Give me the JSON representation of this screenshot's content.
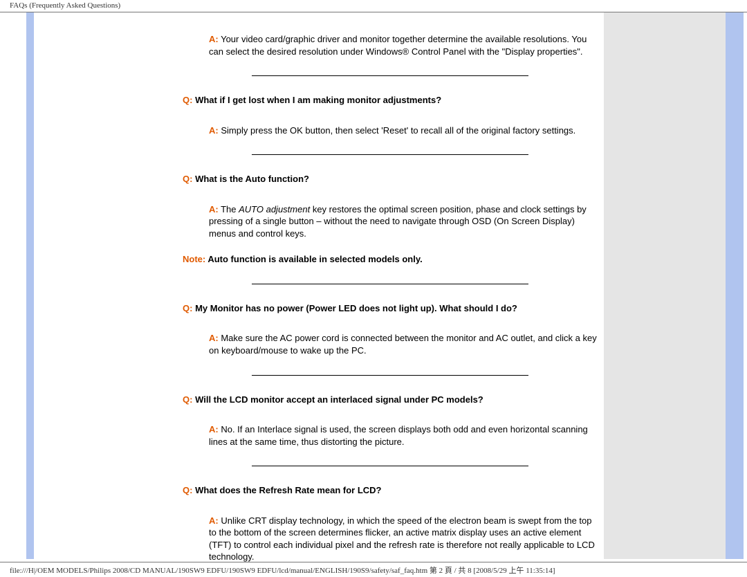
{
  "header": "FAQs (Frequently Asked Questions)",
  "footer": "file:///H|/OEM MODELS/Philips 2008/CD MANUAL/190SW9 EDFU/190SW9 EDFU/lcd/manual/ENGLISH/190S9/safety/saf_faq.htm 第 2 頁 / 共 8 [2008/5/29 上午 11:35:14]",
  "labels": {
    "q": "Q:",
    "a": "A:",
    "note": "Note:"
  },
  "faq": [
    {
      "a_pre": " Your video card/graphic driver and monitor together determine the available resolutions. You can select the desired resolution under Windows® Control Panel with the \"Display properties\"."
    },
    {
      "q": " What if I get lost when I am making monitor adjustments?",
      "a": " Simply press the OK button, then select 'Reset' to recall all of the original factory settings."
    },
    {
      "q": " What is the Auto function?",
      "a_part1": " The ",
      "a_italic": "AUTO adjustment",
      "a_part2": " key restores the optimal screen position, phase and clock settings by pressing of a single button – without the need to navigate through OSD (On Screen Display) menus and control keys.",
      "note": " Auto function is available in selected models only."
    },
    {
      "q": " My Monitor has no power (Power LED does not light up). What should I do?",
      "a": " Make sure the AC power cord is connected between the monitor and AC outlet, and click a key on keyboard/mouse to wake up the PC."
    },
    {
      "q": " Will the LCD monitor accept an interlaced signal under PC models?",
      "a": " No. If an Interlace signal is used, the screen displays both odd and even horizontal scanning lines at the same time, thus distorting the picture."
    },
    {
      "q": " What does the Refresh Rate mean for LCD?",
      "a": " Unlike CRT display technology, in which the speed of the electron beam is swept from the top to the bottom of the screen determines flicker, an active matrix display uses an active element (TFT) to control each individual pixel and the refresh rate is therefore not really applicable to LCD technology."
    }
  ]
}
